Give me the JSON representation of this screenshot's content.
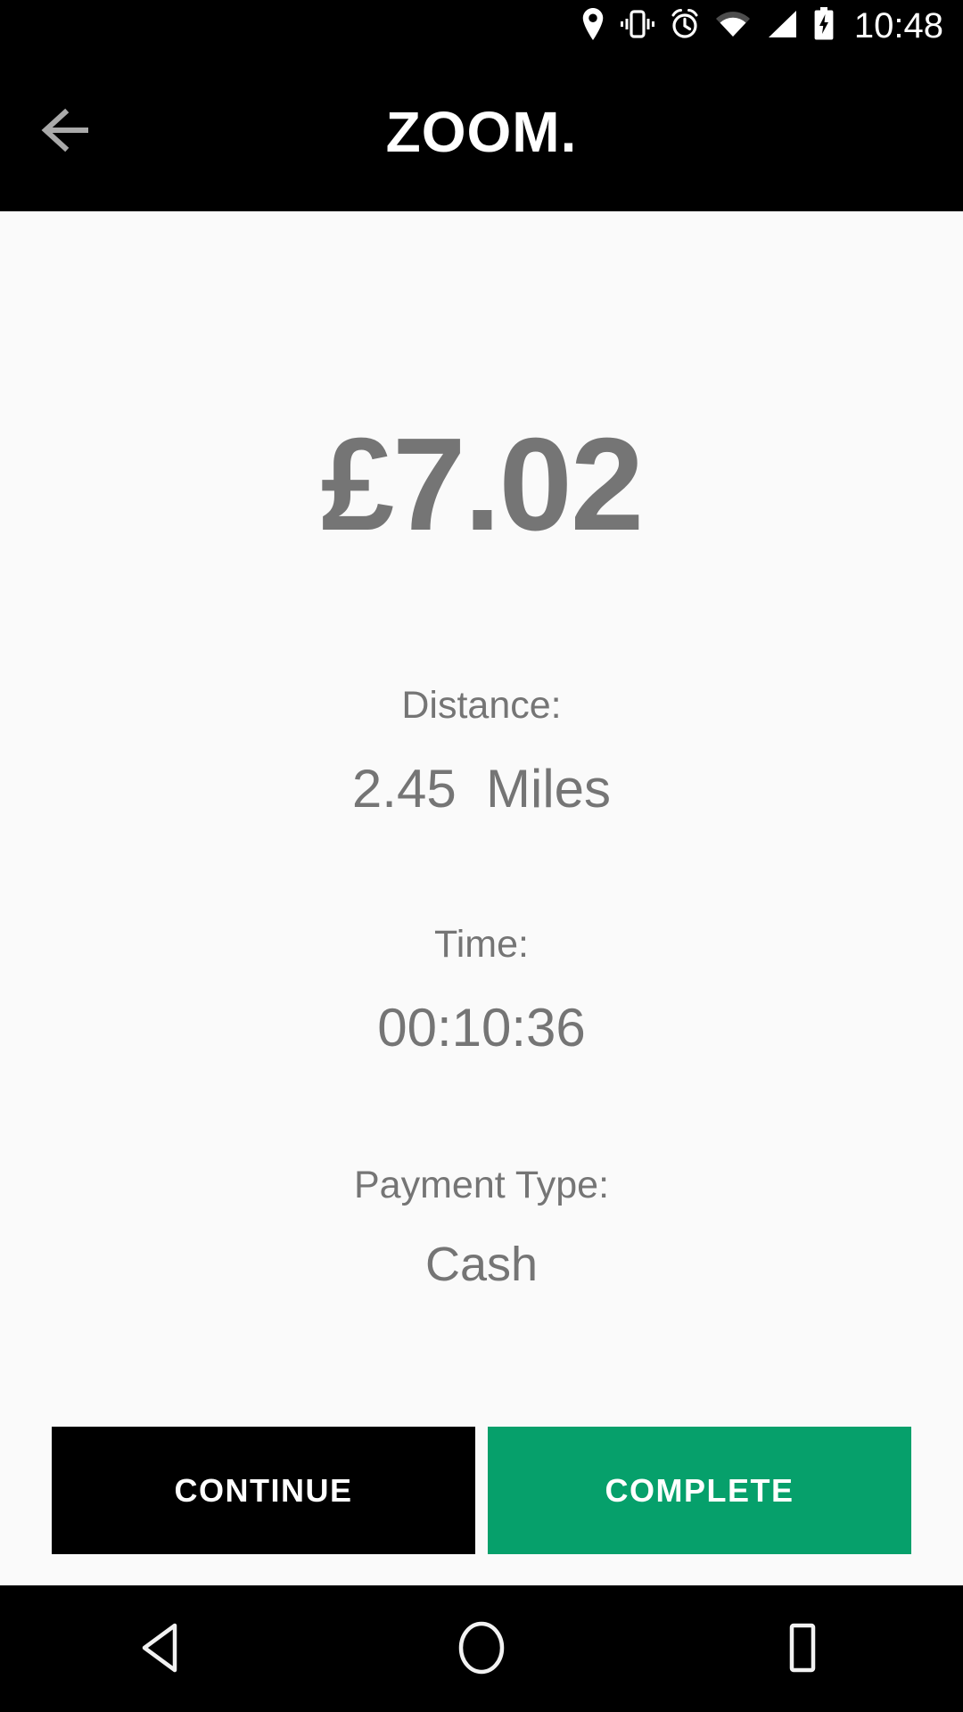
{
  "status_bar": {
    "time": "10:48",
    "icons": [
      {
        "name": "location-icon",
        "label": "location"
      },
      {
        "name": "vibrate-icon",
        "label": "vibrate"
      },
      {
        "name": "alarm-icon",
        "label": "alarm"
      },
      {
        "name": "wifi-icon",
        "label": "wifi"
      },
      {
        "name": "cellular-signal-icon",
        "label": "signal"
      },
      {
        "name": "battery-charging-icon",
        "label": "battery charging"
      }
    ],
    "background_color": "#000000",
    "foreground_color": "#ffffff"
  },
  "app_bar": {
    "title": "ZOOM.",
    "back_icon": "back-arrow-icon",
    "background_color": "#000000",
    "title_color": "#ffffff",
    "back_icon_color": "#aaaaaa"
  },
  "main": {
    "fare": "£7.02",
    "fields": [
      {
        "label": "Distance:",
        "value": "2.45  Miles"
      },
      {
        "label": "Time:",
        "value": "00:10:36"
      },
      {
        "label": "Payment Type:",
        "value": "Cash"
      }
    ],
    "text_color": "#757575",
    "background_color": "#fafafa"
  },
  "actions": {
    "continue_label": "CONTINUE",
    "complete_label": "COMPLETE",
    "continue_color": "#000000",
    "complete_color": "#06a06b"
  },
  "nav_bar": {
    "back_icon": "nav-back-triangle-icon",
    "home_icon": "nav-home-circle-icon",
    "recents_icon": "nav-recents-square-icon",
    "background_color": "#000000"
  }
}
